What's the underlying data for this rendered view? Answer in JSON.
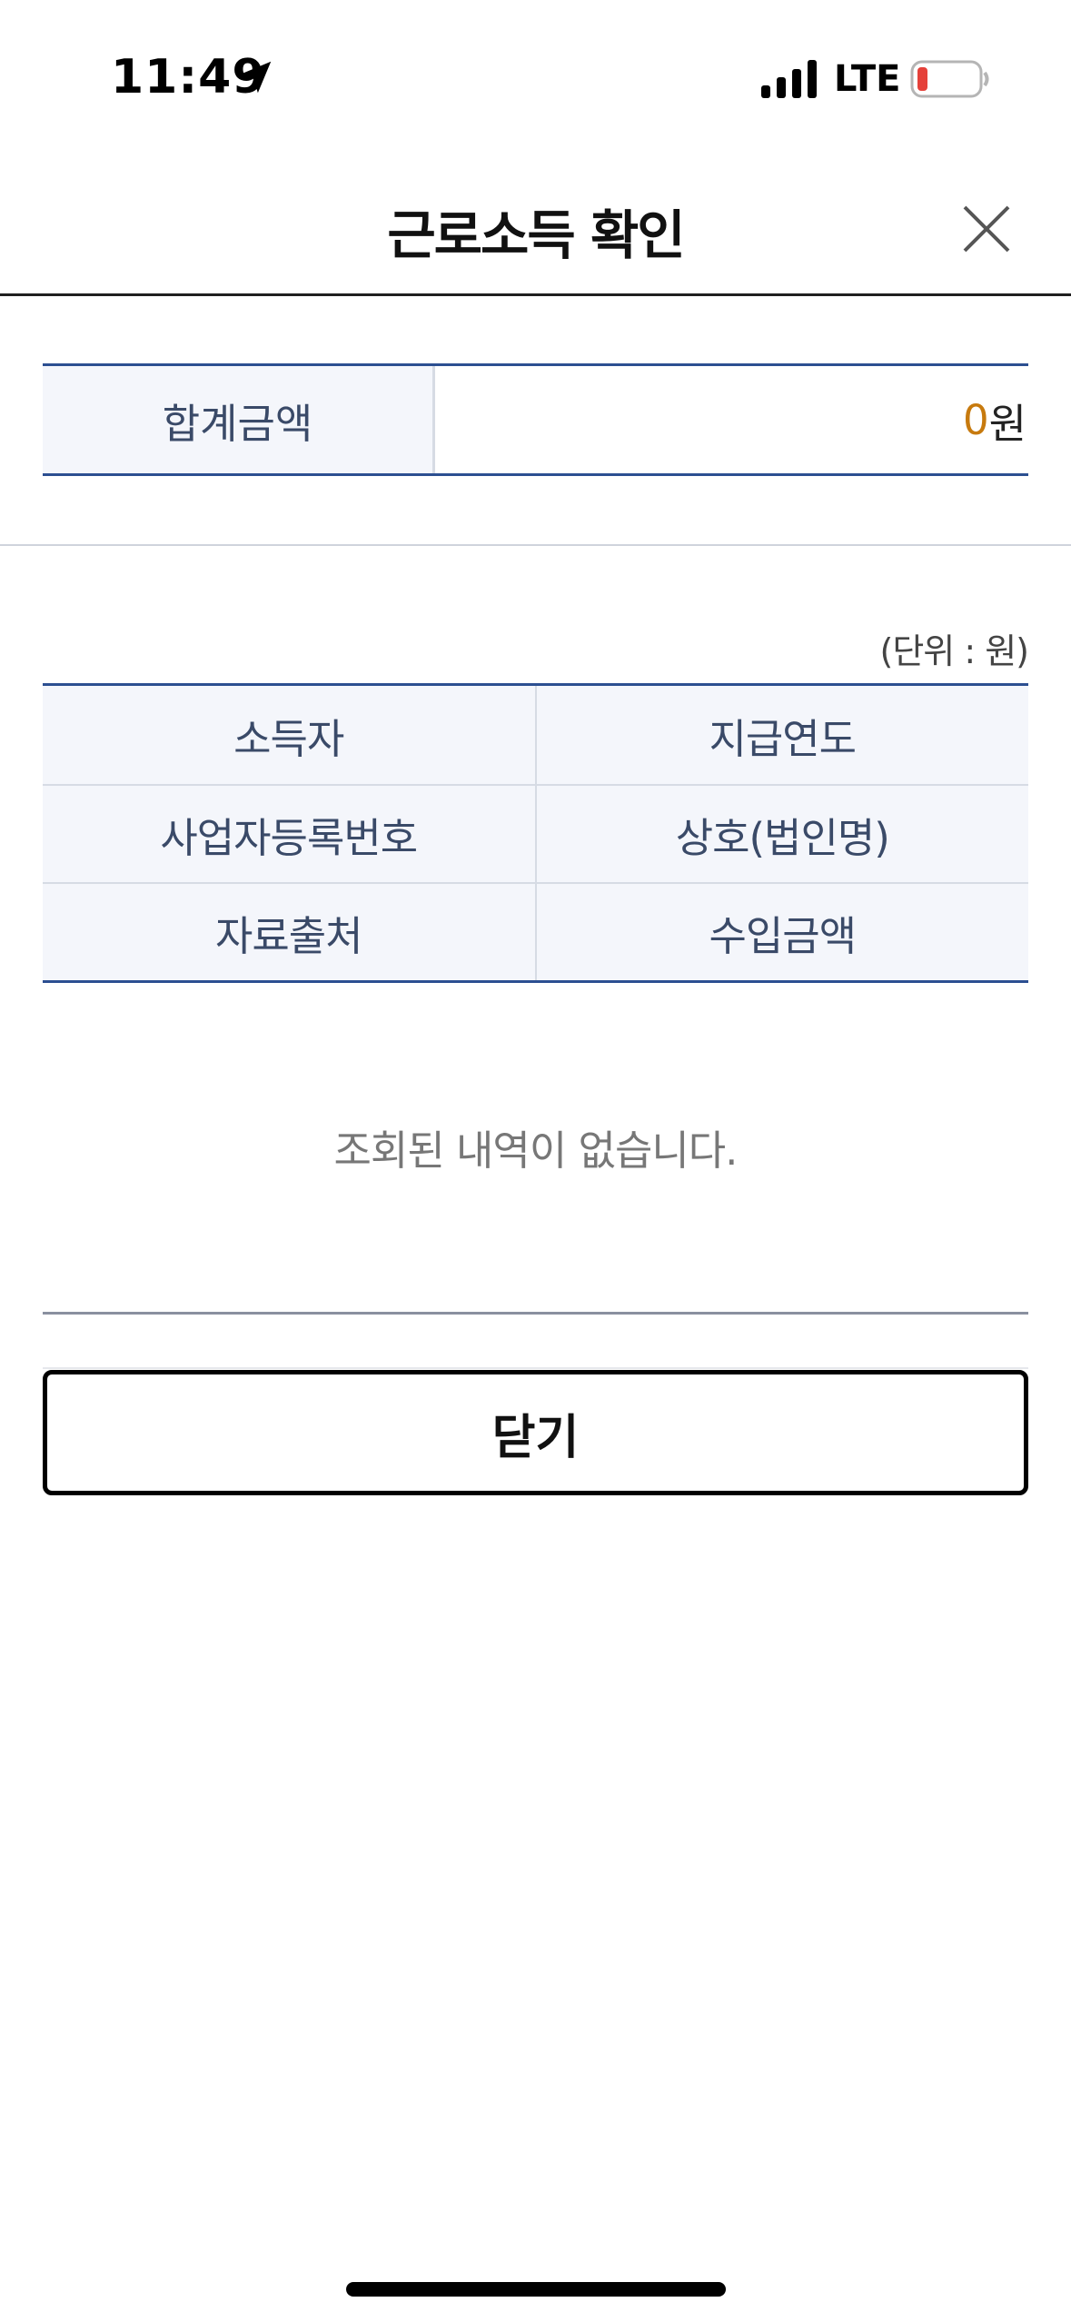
{
  "status_bar": {
    "time": "11:49",
    "network": "LTE",
    "icons": [
      "location-arrow-icon",
      "signal-icon",
      "battery-low-icon"
    ],
    "battery_color": "#e5413a"
  },
  "header": {
    "title": "근로소득 확인",
    "close_icon": "close-icon"
  },
  "summary": {
    "label": "합계금액",
    "amount": "0",
    "unit": "원",
    "amount_color": "#c77a0e"
  },
  "unit_note": "(단위 : 원)",
  "table": {
    "rows": [
      [
        "소득자",
        "지급연도"
      ],
      [
        "사업자등록번호",
        "상호(법인명)"
      ],
      [
        "자료출처",
        "수입금액"
      ]
    ]
  },
  "empty_message": "조회된 내역이 없습니다.",
  "close_button_label": "닫기",
  "colors": {
    "accent_border": "#2c4f91",
    "header_bg": "#f4f6fb",
    "label_text": "#3a4a68"
  }
}
